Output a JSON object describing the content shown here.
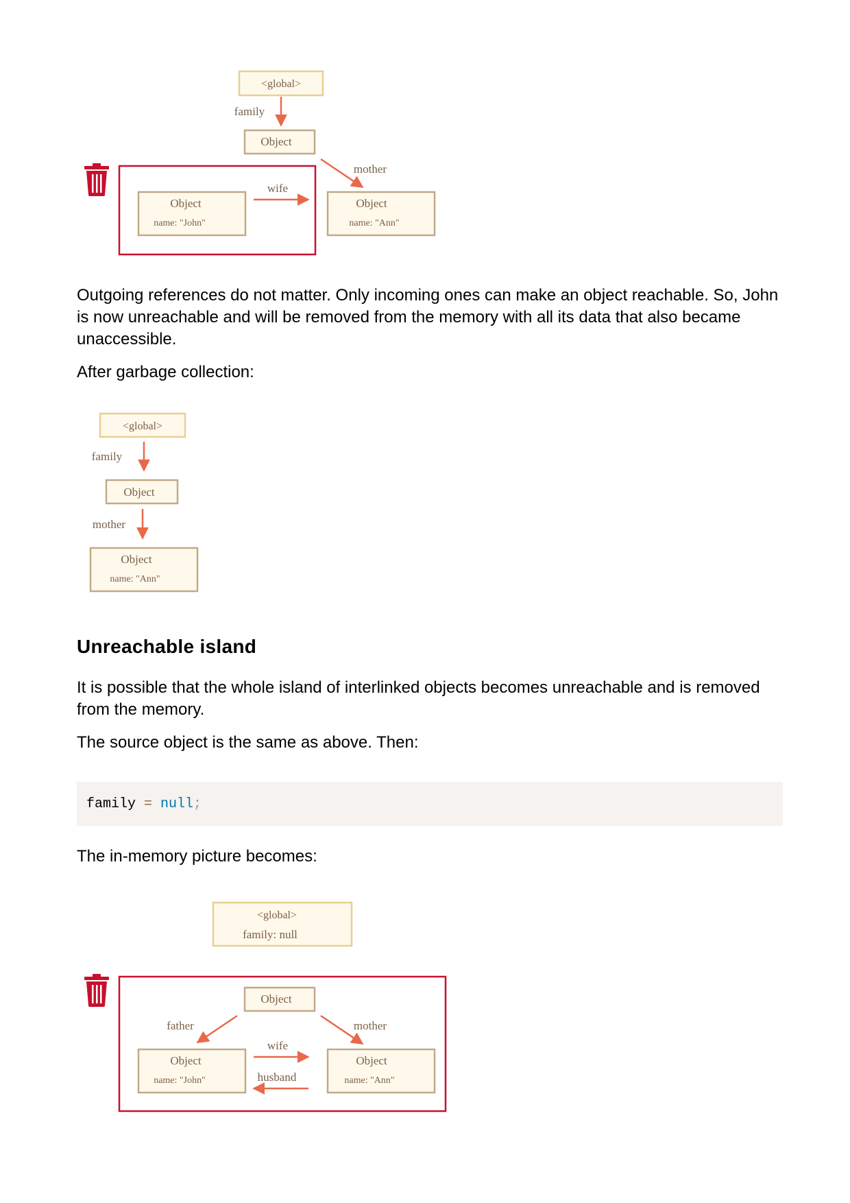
{
  "diagram1": {
    "global_label": "<global>",
    "family_label": "family",
    "object_label": "Object",
    "mother_label": "mother",
    "wife_label": "wife",
    "john_title": "Object",
    "john_name": "name: \"John\"",
    "ann_title": "Object",
    "ann_name": "name: \"Ann\""
  },
  "paragraphs": {
    "p1": "Outgoing references do not matter. Only incoming ones can make an object reachable. So, John is now unreachable and will be removed from the memory with all its data that also became unaccessible.",
    "p2": "After garbage collection:",
    "heading": "Unreachable island",
    "p3": "It is possible that the whole island of interlinked objects becomes unreachable and is removed from the memory.",
    "p4": "The source object is the same as above. Then:",
    "p5": "The in-memory picture becomes:"
  },
  "diagram2": {
    "global_label": "<global>",
    "family_label": "family",
    "object_label": "Object",
    "mother_label": "mother",
    "ann_title": "Object",
    "ann_name": "name: \"Ann\""
  },
  "code": {
    "var": "family",
    "op": " = ",
    "kw": "null",
    "punct": ";"
  },
  "diagram3": {
    "global_label": "<global>",
    "global_family": "family: null",
    "object_label": "Object",
    "father_label": "father",
    "mother_label": "mother",
    "wife_label": "wife",
    "husband_label": "husband",
    "john_title": "Object",
    "john_name": "name: \"John\"",
    "ann_title": "Object",
    "ann_name": "name: \"Ann\""
  },
  "colors": {
    "global_border": "#e8cf94",
    "global_fill": "#fff9eb",
    "object_border": "#c0aa88",
    "object_fill": "#fff9eb",
    "arrow": "#e8694a",
    "label_text": "#7a6048",
    "unreachable_border": "#c8102e",
    "trash": "#c8102e"
  },
  "icons": [
    "trash-icon"
  ]
}
